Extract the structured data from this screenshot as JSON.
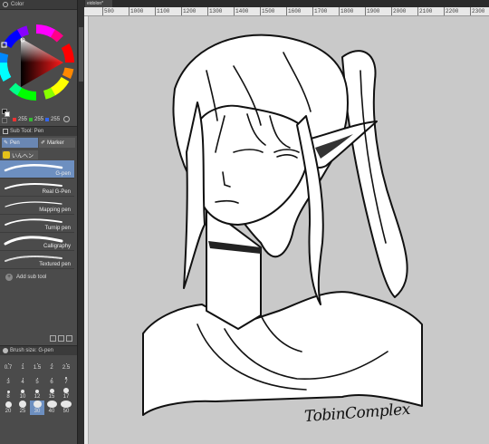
{
  "color_panel": {
    "title": "Color"
  },
  "rgb": {
    "r": "255",
    "g": "255",
    "b": "255"
  },
  "subtool": {
    "header": "Sub Tool: Pen"
  },
  "tabs": [
    {
      "label": "Pen"
    },
    {
      "label": "Marker"
    }
  ],
  "group_label": "いんへン",
  "brushes": [
    {
      "name": "G-pen"
    },
    {
      "name": "Real G-Pen"
    },
    {
      "name": "Mapping pen"
    },
    {
      "name": "Turnip pen"
    },
    {
      "name": "Calligraphy"
    },
    {
      "name": "Textured pen"
    }
  ],
  "add_sub_tool": "Add sub tool",
  "brush_size": {
    "header": "Brush size: G-pen"
  },
  "size_values": [
    "0.7",
    "1",
    "1.5",
    "2",
    "2.5",
    "3",
    "4",
    "5",
    "6",
    "7",
    "8",
    "10",
    "12",
    "15",
    "17",
    "20",
    "25",
    "30",
    "40",
    "50"
  ],
  "document": {
    "tab_name": "eidolon*"
  },
  "ruler_ticks": [
    "500",
    "1000",
    "1100",
    "1200",
    "1300",
    "1400",
    "1500",
    "1600",
    "1700",
    "1800",
    "1900",
    "2000",
    "2100",
    "2200",
    "2300"
  ],
  "signature": "TobinComplex"
}
